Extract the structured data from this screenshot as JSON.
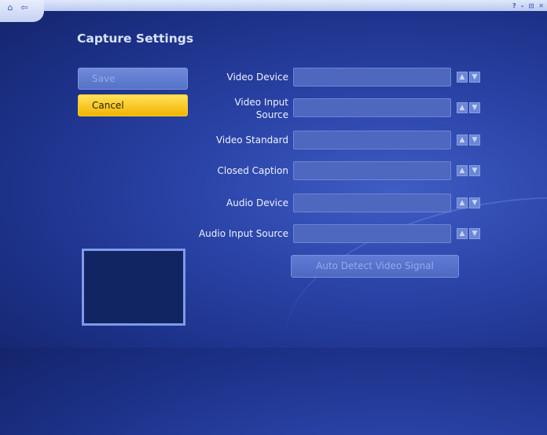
{
  "window": {
    "controls": [
      "?",
      "–",
      "⊡",
      "✕"
    ],
    "nav_home_icon": "home-icon",
    "nav_back_icon": "back-arrow-icon"
  },
  "page": {
    "title": "Capture Settings"
  },
  "actions": {
    "save_label": "Save",
    "cancel_label": "Cancel"
  },
  "settings": [
    {
      "label": "Video Device",
      "value": ""
    },
    {
      "label": "Video Input Source",
      "value": ""
    },
    {
      "label": "Video Standard",
      "value": ""
    },
    {
      "label": "Closed Caption",
      "value": ""
    },
    {
      "label": "Audio Device",
      "value": ""
    },
    {
      "label": "Audio Input Source",
      "value": ""
    }
  ],
  "detect": {
    "label": "Auto Detect Video Signal"
  },
  "colors": {
    "background": "#2b44a8",
    "accent": "#f2b400",
    "title_text": "#d8e2ff"
  }
}
